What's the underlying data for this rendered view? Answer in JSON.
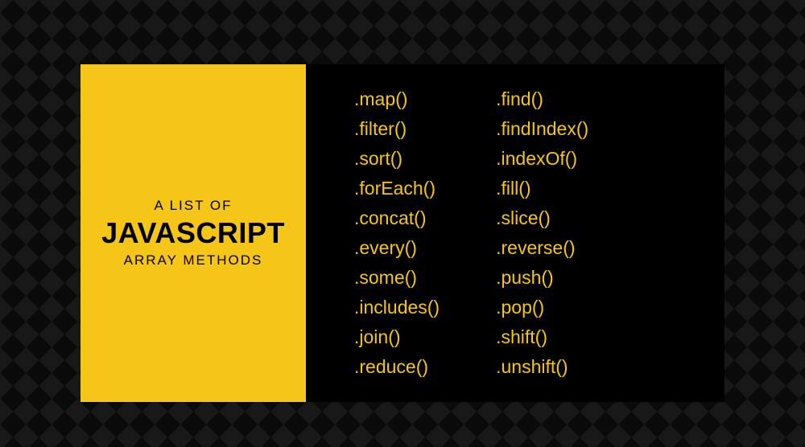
{
  "header": {
    "pretitle": "A LIST OF",
    "title": "JAVASCRIPT",
    "subtitle": "ARRAY METHODS"
  },
  "columns": {
    "left": [
      ".map()",
      ".filter()",
      ".sort()",
      ".forEach()",
      ".concat()",
      ".every()",
      ".some()",
      ".includes()",
      ".join()",
      ".reduce()"
    ],
    "right": [
      ".find()",
      ".findIndex()",
      ".indexOf()",
      ".fill()",
      ".slice()",
      ".reverse()",
      ".push()",
      ".pop()",
      ".shift()",
      ".unshift()"
    ]
  }
}
